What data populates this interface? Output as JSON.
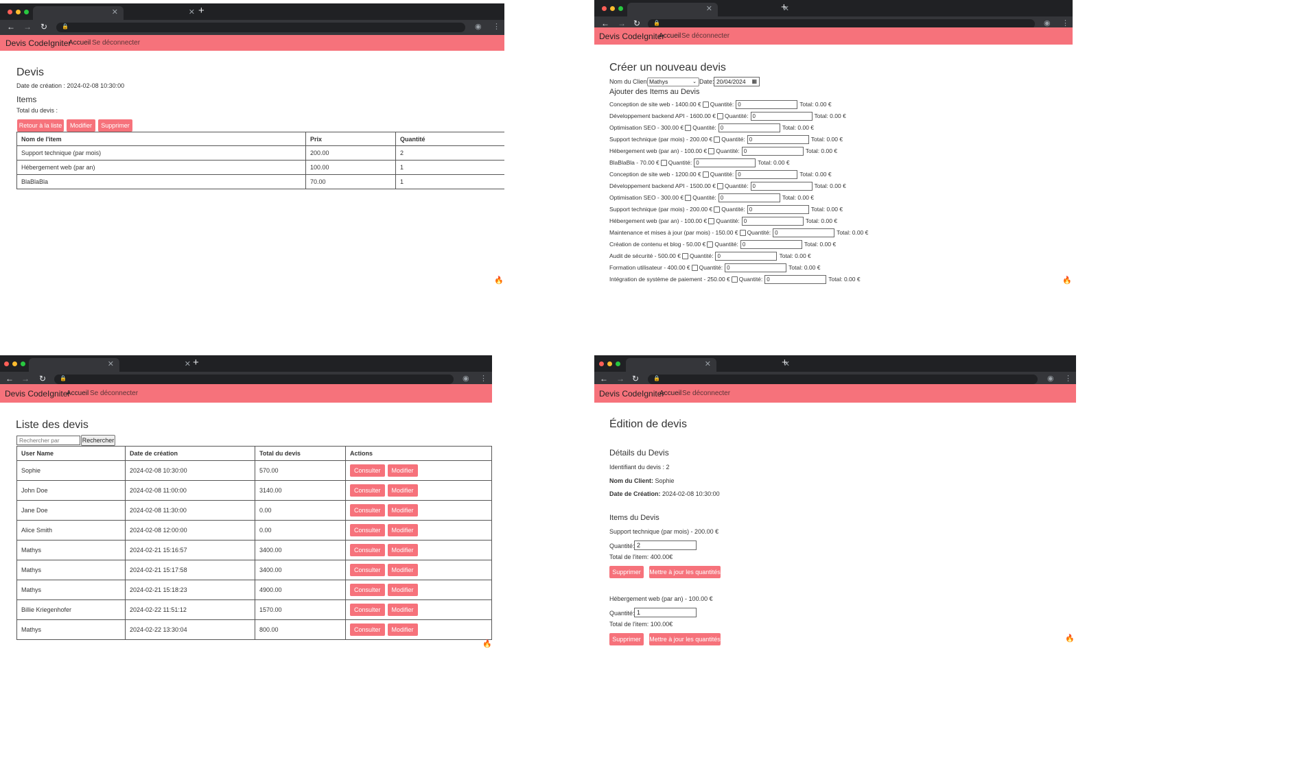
{
  "brand": "Devis CodeIgniter",
  "nav": {
    "home": "Accueil",
    "logout": "Se déconnecter"
  },
  "icons": {
    "flame": "🔥",
    "close": "✕",
    "plus": "+",
    "back": "←",
    "forward": "→",
    "reload": "↻",
    "lock": "🔒",
    "profile": "◉",
    "menu": "⋮"
  },
  "view": {
    "title": "Devis",
    "created": "Date de création : 2024-02-08 10:30:00",
    "items_title": "Items",
    "total": "Total du devis :",
    "buttons": {
      "back": "Retour à la liste",
      "edit": "Modifier",
      "delete": "Supprimer"
    },
    "headers": [
      "Nom de l'item",
      "Prix",
      "Quantité"
    ],
    "rows": [
      [
        "Support technique (par mois)",
        "200.00",
        "2"
      ],
      [
        "Hébergement web (par an)",
        "100.00",
        "1"
      ],
      [
        "BlaBlaBla",
        "70.00",
        "1"
      ]
    ]
  },
  "create": {
    "title": "Créer un nouveau devis",
    "client_label": "Nom du Client:",
    "client_value": "Mathys",
    "date_label": "Date:",
    "date_value": "20/04/2024",
    "add_title": "Ajouter des Items au Devis",
    "qty_label": "Quantité:",
    "items": [
      {
        "label": "Conception de site web - 1400.00 €",
        "qty": "0",
        "total": "Total: 0.00 €"
      },
      {
        "label": "Développement backend API - 1600.00 €",
        "qty": "0",
        "total": "Total: 0.00 €"
      },
      {
        "label": "Optimisation SEO - 300.00 €",
        "qty": "0",
        "total": "Total: 0.00 €"
      },
      {
        "label": "Support technique (par mois) - 200.00 €",
        "qty": "0",
        "total": "Total: 0.00 €"
      },
      {
        "label": "Hébergement web (par an) - 100.00 €",
        "qty": "0",
        "total": "Total: 0.00 €"
      },
      {
        "label": "BlaBlaBla - 70.00 €",
        "qty": "0",
        "total": "Total: 0.00 €"
      },
      {
        "label": "Conception de site web - 1200.00 €",
        "qty": "0",
        "total": "Total: 0.00 €"
      },
      {
        "label": "Développement backend API - 1500.00 €",
        "qty": "0",
        "total": "Total: 0.00 €"
      },
      {
        "label": "Optimisation SEO - 300.00 €",
        "qty": "0",
        "total": "Total: 0.00 €"
      },
      {
        "label": "Support technique (par mois) - 200.00 €",
        "qty": "0",
        "total": "Total: 0.00 €"
      },
      {
        "label": "Hébergement web (par an) - 100.00 €",
        "qty": "0",
        "total": "Total: 0.00 €"
      },
      {
        "label": "Maintenance et mises à jour (par mois) - 150.00 €",
        "qty": "0",
        "total": "Total: 0.00 €"
      },
      {
        "label": "Création de contenu et blog - 50.00 €",
        "qty": "0",
        "total": "Total: 0.00 €"
      },
      {
        "label": "Audit de sécurité - 500.00 €",
        "qty": "0",
        "total": "Total: 0.00 €"
      },
      {
        "label": "Formation utilisateur - 400.00 €",
        "qty": "0",
        "total": "Total: 0.00 €"
      },
      {
        "label": "Intégration de système de paiement - 250.00 €",
        "qty": "0",
        "total": "Total: 0.00 €"
      }
    ]
  },
  "list": {
    "title": "Liste des devis",
    "search_placeholder": "Rechercher par user_name",
    "search_button": "Rechercher",
    "headers": [
      "User Name",
      "Date de création",
      "Total du devis",
      "Actions"
    ],
    "consult": "Consulter",
    "edit": "Modifier",
    "rows": [
      [
        "Sophie",
        "2024-02-08 10:30:00",
        "570.00"
      ],
      [
        "John Doe",
        "2024-02-08 11:00:00",
        "3140.00"
      ],
      [
        "Jane Doe",
        "2024-02-08 11:30:00",
        "0.00"
      ],
      [
        "Alice Smith",
        "2024-02-08 12:00:00",
        "0.00"
      ],
      [
        "Mathys",
        "2024-02-21 15:16:57",
        "3400.00"
      ],
      [
        "Mathys",
        "2024-02-21 15:17:58",
        "3400.00"
      ],
      [
        "Mathys",
        "2024-02-21 15:18:23",
        "4900.00"
      ],
      [
        "Billie Kriegenhofer",
        "2024-02-22 11:51:12",
        "1570.00"
      ],
      [
        "Mathys",
        "2024-02-22 13:30:04",
        "800.00"
      ]
    ]
  },
  "edit": {
    "title": "Édition de devis",
    "details_title": "Détails du Devis",
    "id_text": "Identifiant du devis : 2",
    "client_label": "Nom du Client:",
    "client_value": "Sophie",
    "date_label": "Date de Création:",
    "date_value": "2024-02-08 10:30:00",
    "items_title": "Items du Devis",
    "qty_label": "Quantité:",
    "delete": "Supprimer",
    "update": "Mettre à jour les quantités",
    "items": [
      {
        "label": "Support technique (par mois) - 200.00 €",
        "qty": "2",
        "total": "Total de l'item: 400.00€"
      },
      {
        "label": "Hébergement web (par an) - 100.00 €",
        "qty": "1",
        "total": "Total de l'item: 100.00€"
      }
    ]
  }
}
